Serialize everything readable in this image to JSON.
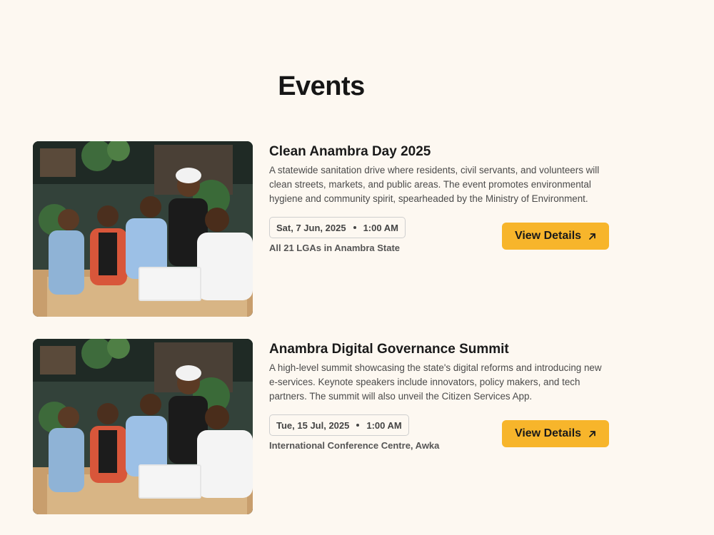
{
  "page": {
    "title": "Events"
  },
  "events": [
    {
      "title": "Clean Anambra Day 2025",
      "description": "A statewide sanitation drive where residents, civil servants, and volunteers will clean streets, markets, and public areas. The event promotes environmental hygiene and community spirit, spearheaded by the Ministry of Environment.",
      "date": "Sat, 7 Jun, 2025",
      "time": "1:00 AM",
      "location": "All 21 LGAs in Anambra State",
      "button_label": "View Details",
      "button_icon": "arrow-up-right-icon"
    },
    {
      "title": "Anambra Digital Governance Summit",
      "description": "A high-level summit showcasing the state's digital reforms and introducing new e-services. Keynote speakers include innovators, policy makers, and tech partners. The summit will also unveil the Citizen Services App.",
      "date": "Tue, 15 Jul, 2025",
      "time": "1:00 AM",
      "location": "International Conference Centre, Awka",
      "button_label": "View Details",
      "button_icon": "arrow-up-right-icon"
    }
  ],
  "colors": {
    "background": "#fdf8f1",
    "accent": "#f7b52b",
    "text": "#1a1a1a"
  }
}
